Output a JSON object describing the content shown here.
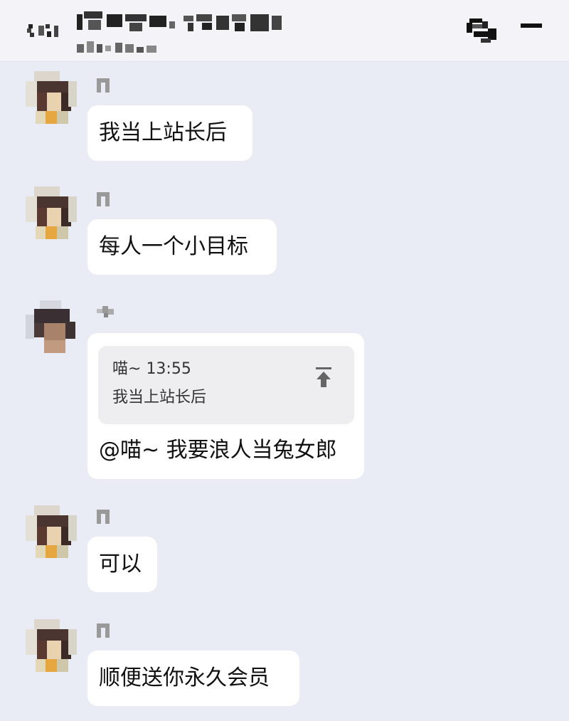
{
  "header": {
    "title_pixelated": true,
    "subtitle_pixelated": true
  },
  "messages": [
    {
      "text": "我当上站长后"
    },
    {
      "text": "每人一个小目标"
    },
    {
      "quote": {
        "author": "喵~",
        "time": "13:55",
        "text": "我当上站长后"
      },
      "text": "@喵~ 我要浪人当兔女郎"
    },
    {
      "text": "可以"
    },
    {
      "text": "顺便送你永久会员"
    }
  ],
  "colors": {
    "background": "#eaecf5",
    "bubble": "#ffffff",
    "quote_box": "#eeeef0",
    "header": "#f4f4f8"
  },
  "icons": [
    "back-icon",
    "chat-icon",
    "menu-icon",
    "scroll-to-quote-icon"
  ]
}
